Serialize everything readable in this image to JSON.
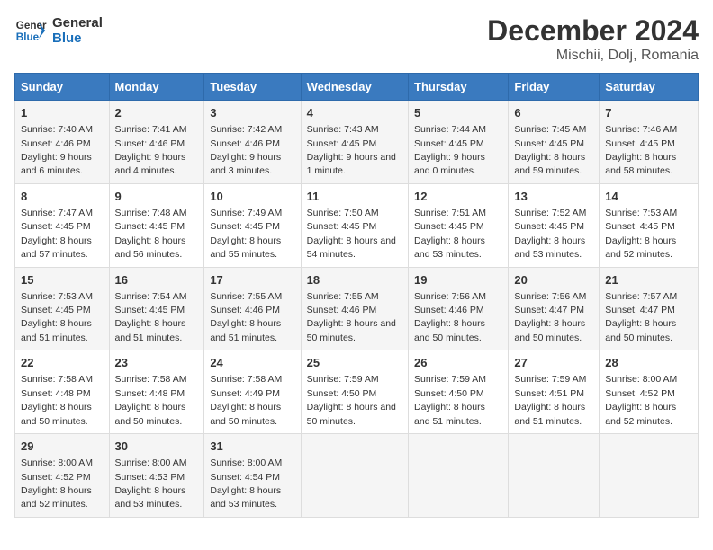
{
  "logo": {
    "general": "General",
    "blue": "Blue"
  },
  "title": "December 2024",
  "subtitle": "Mischii, Dolj, Romania",
  "days_header": [
    "Sunday",
    "Monday",
    "Tuesday",
    "Wednesday",
    "Thursday",
    "Friday",
    "Saturday"
  ],
  "weeks": [
    [
      {
        "day": "1",
        "sunrise": "Sunrise: 7:40 AM",
        "sunset": "Sunset: 4:46 PM",
        "daylight": "Daylight: 9 hours and 6 minutes."
      },
      {
        "day": "2",
        "sunrise": "Sunrise: 7:41 AM",
        "sunset": "Sunset: 4:46 PM",
        "daylight": "Daylight: 9 hours and 4 minutes."
      },
      {
        "day": "3",
        "sunrise": "Sunrise: 7:42 AM",
        "sunset": "Sunset: 4:46 PM",
        "daylight": "Daylight: 9 hours and 3 minutes."
      },
      {
        "day": "4",
        "sunrise": "Sunrise: 7:43 AM",
        "sunset": "Sunset: 4:45 PM",
        "daylight": "Daylight: 9 hours and 1 minute."
      },
      {
        "day": "5",
        "sunrise": "Sunrise: 7:44 AM",
        "sunset": "Sunset: 4:45 PM",
        "daylight": "Daylight: 9 hours and 0 minutes."
      },
      {
        "day": "6",
        "sunrise": "Sunrise: 7:45 AM",
        "sunset": "Sunset: 4:45 PM",
        "daylight": "Daylight: 8 hours and 59 minutes."
      },
      {
        "day": "7",
        "sunrise": "Sunrise: 7:46 AM",
        "sunset": "Sunset: 4:45 PM",
        "daylight": "Daylight: 8 hours and 58 minutes."
      }
    ],
    [
      {
        "day": "8",
        "sunrise": "Sunrise: 7:47 AM",
        "sunset": "Sunset: 4:45 PM",
        "daylight": "Daylight: 8 hours and 57 minutes."
      },
      {
        "day": "9",
        "sunrise": "Sunrise: 7:48 AM",
        "sunset": "Sunset: 4:45 PM",
        "daylight": "Daylight: 8 hours and 56 minutes."
      },
      {
        "day": "10",
        "sunrise": "Sunrise: 7:49 AM",
        "sunset": "Sunset: 4:45 PM",
        "daylight": "Daylight: 8 hours and 55 minutes."
      },
      {
        "day": "11",
        "sunrise": "Sunrise: 7:50 AM",
        "sunset": "Sunset: 4:45 PM",
        "daylight": "Daylight: 8 hours and 54 minutes."
      },
      {
        "day": "12",
        "sunrise": "Sunrise: 7:51 AM",
        "sunset": "Sunset: 4:45 PM",
        "daylight": "Daylight: 8 hours and 53 minutes."
      },
      {
        "day": "13",
        "sunrise": "Sunrise: 7:52 AM",
        "sunset": "Sunset: 4:45 PM",
        "daylight": "Daylight: 8 hours and 53 minutes."
      },
      {
        "day": "14",
        "sunrise": "Sunrise: 7:53 AM",
        "sunset": "Sunset: 4:45 PM",
        "daylight": "Daylight: 8 hours and 52 minutes."
      }
    ],
    [
      {
        "day": "15",
        "sunrise": "Sunrise: 7:53 AM",
        "sunset": "Sunset: 4:45 PM",
        "daylight": "Daylight: 8 hours and 51 minutes."
      },
      {
        "day": "16",
        "sunrise": "Sunrise: 7:54 AM",
        "sunset": "Sunset: 4:45 PM",
        "daylight": "Daylight: 8 hours and 51 minutes."
      },
      {
        "day": "17",
        "sunrise": "Sunrise: 7:55 AM",
        "sunset": "Sunset: 4:46 PM",
        "daylight": "Daylight: 8 hours and 51 minutes."
      },
      {
        "day": "18",
        "sunrise": "Sunrise: 7:55 AM",
        "sunset": "Sunset: 4:46 PM",
        "daylight": "Daylight: 8 hours and 50 minutes."
      },
      {
        "day": "19",
        "sunrise": "Sunrise: 7:56 AM",
        "sunset": "Sunset: 4:46 PM",
        "daylight": "Daylight: 8 hours and 50 minutes."
      },
      {
        "day": "20",
        "sunrise": "Sunrise: 7:56 AM",
        "sunset": "Sunset: 4:47 PM",
        "daylight": "Daylight: 8 hours and 50 minutes."
      },
      {
        "day": "21",
        "sunrise": "Sunrise: 7:57 AM",
        "sunset": "Sunset: 4:47 PM",
        "daylight": "Daylight: 8 hours and 50 minutes."
      }
    ],
    [
      {
        "day": "22",
        "sunrise": "Sunrise: 7:58 AM",
        "sunset": "Sunset: 4:48 PM",
        "daylight": "Daylight: 8 hours and 50 minutes."
      },
      {
        "day": "23",
        "sunrise": "Sunrise: 7:58 AM",
        "sunset": "Sunset: 4:48 PM",
        "daylight": "Daylight: 8 hours and 50 minutes."
      },
      {
        "day": "24",
        "sunrise": "Sunrise: 7:58 AM",
        "sunset": "Sunset: 4:49 PM",
        "daylight": "Daylight: 8 hours and 50 minutes."
      },
      {
        "day": "25",
        "sunrise": "Sunrise: 7:59 AM",
        "sunset": "Sunset: 4:50 PM",
        "daylight": "Daylight: 8 hours and 50 minutes."
      },
      {
        "day": "26",
        "sunrise": "Sunrise: 7:59 AM",
        "sunset": "Sunset: 4:50 PM",
        "daylight": "Daylight: 8 hours and 51 minutes."
      },
      {
        "day": "27",
        "sunrise": "Sunrise: 7:59 AM",
        "sunset": "Sunset: 4:51 PM",
        "daylight": "Daylight: 8 hours and 51 minutes."
      },
      {
        "day": "28",
        "sunrise": "Sunrise: 8:00 AM",
        "sunset": "Sunset: 4:52 PM",
        "daylight": "Daylight: 8 hours and 52 minutes."
      }
    ],
    [
      {
        "day": "29",
        "sunrise": "Sunrise: 8:00 AM",
        "sunset": "Sunset: 4:52 PM",
        "daylight": "Daylight: 8 hours and 52 minutes."
      },
      {
        "day": "30",
        "sunrise": "Sunrise: 8:00 AM",
        "sunset": "Sunset: 4:53 PM",
        "daylight": "Daylight: 8 hours and 53 minutes."
      },
      {
        "day": "31",
        "sunrise": "Sunrise: 8:00 AM",
        "sunset": "Sunset: 4:54 PM",
        "daylight": "Daylight: 8 hours and 53 minutes."
      },
      null,
      null,
      null,
      null
    ]
  ]
}
